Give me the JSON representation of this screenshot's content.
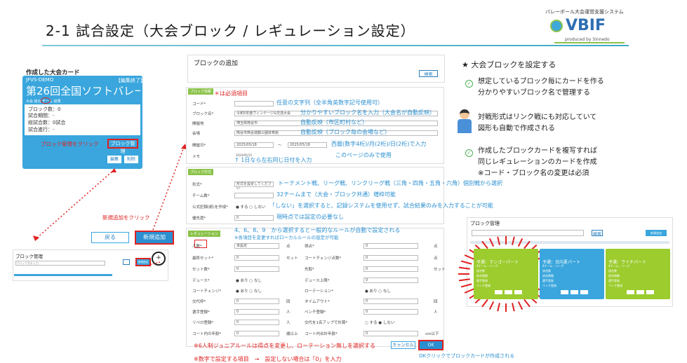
{
  "header": {
    "title": "2-1 試合設定（大会ブロック / レギュレーション設定）",
    "logo_caption": "バレーボール大会運営支援システム",
    "logo_text": "VBIF",
    "logo_produced": "produced by Sinnedo"
  },
  "card": {
    "label": "作成した大会カード",
    "id": "JFVS-DEMO",
    "edit_badge": "【編集終了】",
    "name": "第26回全国ソフトバレー・",
    "tabs": "大会 結合 チーム 結果",
    "lines": [
      "ブロック数：0",
      "試合期間：-",
      "総試合数：0試合",
      "試合進行：-"
    ],
    "click_note": "ブロック管理をクリック",
    "block_btn": "ブロック管理",
    "edit_btn": "編集",
    "delete_btn": "削除"
  },
  "list_panel": {
    "title": "ブロック管理",
    "search": "ブロック名を入力",
    "btn_new": "新規追加"
  },
  "new_note": "新規追加をクリック",
  "back_btn": "戻る",
  "new_btn": "新規追加",
  "form": {
    "title": "ブロックの追加",
    "search_btn": "検索",
    "sec1": "ブロック情報",
    "required_note": "＊は必須項目",
    "fields1": [
      {
        "label": "コード*",
        "value": "",
        "ann": "任意の文字列（全半角英数字記号使用可）"
      },
      {
        "label": "ブロック名*",
        "value": "令和5年度ヴィンテージ&交流大会",
        "ann": "分かりやすいブロック名を入力（大会名が自動反映）"
      },
      {
        "label": "開催地",
        "value": "埼玉県熊谷市",
        "ann": "自動反映（市区町村など）"
      },
      {
        "label": "会場",
        "value": "熊谷市熊谷運動公園体育館",
        "ann": "自動反映（ブロック毎の会場など）"
      },
      {
        "label": "開催日*",
        "value": "2025/05/18",
        "value2": "2025/05/18",
        "ann": "西暦(数字4桁)/月(2桁)/日(2桁)で入力"
      },
      {
        "label": "メモ",
        "value": "2024/05/15",
        "ann": "このページのみで使用"
      }
    ],
    "date_note": "↑ 1日なら左右同じ日付を入力",
    "sec2": "ブロック形式",
    "fields2": [
      {
        "label": "形式*",
        "value": "形式を設定してください",
        "ann": "トーナメント戦、リーグ戦、リンクリーグ戦（三角・四角・五角・六角）個別戦から選択"
      },
      {
        "label": "チーム数*",
        "value": "",
        "ann": "32チームまで（大会・ブロック共通）増枠可能"
      },
      {
        "label": "公式記録(紙)を作成*",
        "value": "● する ○ しない",
        "ann": "「しない」を選択すると、記録システムを使用せず、試合結果のみを入力することが可能"
      },
      {
        "label": "優先度*",
        "value": "0",
        "ann": "現時点では設定の必要なし"
      }
    ],
    "sec3": "レギュレーション",
    "reg_note1": "4、6、8、9　から選択すると一般的なルールが自動で設定される",
    "reg_note2": "※各項目を変更すればローカルルールの設定が可能",
    "reg_left": [
      {
        "label": "人数*",
        "value": "未設定"
      },
      {
        "label": "最終セット*",
        "value": "0"
      },
      {
        "label": "セット数*",
        "value": "0"
      },
      {
        "label": "デュース*",
        "value": "● あり ○ なし"
      },
      {
        "label": "コートチェンジ*",
        "value": "● あり ○ なし"
      },
      {
        "label": "交代枠*",
        "value": "0"
      },
      {
        "label": "選手登録*",
        "value": "0"
      },
      {
        "label": "リベロ登録*",
        "value": "0"
      },
      {
        "label": "コート内の年齢*",
        "value": "0"
      }
    ],
    "reg_right": [
      {
        "label": "得点*",
        "value": "0"
      },
      {
        "label": "コートチェンジ点数*",
        "value": "0"
      },
      {
        "label": "先取*",
        "value": "0"
      },
      {
        "label": "デュース上限*",
        "value": "0"
      },
      {
        "label": "ローテーション*",
        "value": "● あり ○ なし"
      },
      {
        "label": "タイムアウト*",
        "value": "0"
      },
      {
        "label": "ベンチ登録*",
        "value": "0"
      },
      {
        "label": "交代を1名アップで計算*",
        "value": "○ する ● しない"
      },
      {
        "label": "コート内合計年齢*",
        "value": "0"
      }
    ],
    "units_left": [
      "点",
      "セット",
      "",
      "",
      "",
      "回",
      "人",
      "人",
      "歳以上"
    ],
    "units_right": [
      "点",
      "点",
      "セット",
      "",
      "",
      "回",
      "人",
      "",
      "cm以下"
    ],
    "jr_note": "※6人制ジュニアルールは得点を変更し、ローテーション無しを選択する",
    "bottom_note": "※数字で設定する項目　→　設定しない場合は「0」を入力",
    "cancel_btn": "キャンセル",
    "ok_btn": "OK",
    "ok_note": "OKクリックでブロックカードが作成される"
  },
  "right": {
    "heading": "★ 大会ブロックを設定する",
    "b1": [
      "想定しているブロック毎にカードを作る",
      "分かりやすいブロック名で管理する"
    ],
    "b2": [
      "対戦形式はリンク戦にも対応していて",
      "図形も自動で作成される"
    ],
    "b3": [
      "作成したブロックカードを複写すれば",
      "同じレギュレーションのカードを作成",
      "※コード・ブロック名の変更は必須"
    ]
  },
  "block_mgr": {
    "title": "ブロック管理",
    "search_btn": "検索",
    "new_btn": "新規追加",
    "cards": [
      {
        "name": "予選：マンゴーパート",
        "color": "#9ccc2e"
      },
      {
        "name": "予選：日向夏パート",
        "color": "#3aa6dd"
      },
      {
        "name": "予選：ライチパート",
        "color": "#9ccc2e"
      }
    ],
    "card_lines": [
      "4チーム・リーグ",
      "試合数",
      "試合期間",
      "選手登録",
      "ベンチ登録"
    ]
  },
  "colors": {
    "accent": "#3aa6dd",
    "green": "#8bc34a",
    "red": "#e02020"
  }
}
